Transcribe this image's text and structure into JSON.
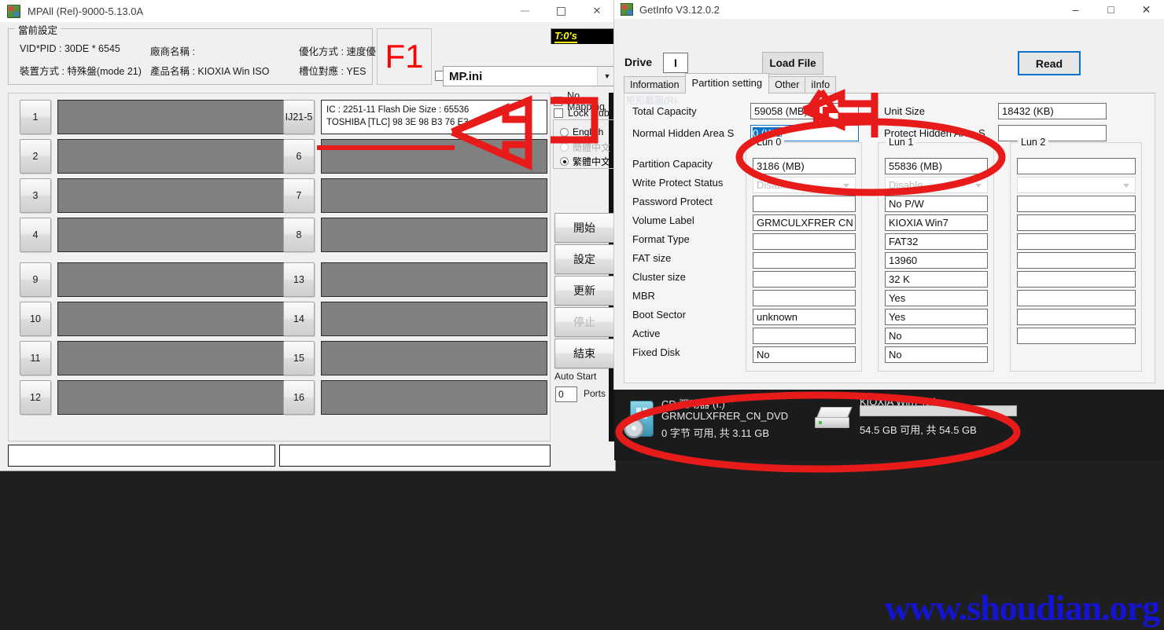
{
  "mpall": {
    "title": "MPAll (Rel)-9000-5.13.0A",
    "window_controls": {
      "minimize": "minimize-icon",
      "maximize": "maximize-icon",
      "close": "close-icon"
    },
    "current_settings": {
      "legend": "當前設定",
      "vid_pid": "VID*PID : 30DE * 6545",
      "device_mode": "裝置方式 : 特殊盤(mode 21)",
      "vendor": "廠商名稱 :",
      "product": "產品名稱 : KIOXIA Win ISO",
      "optimize": "優化方式 : 速度優",
      "slot_map": "槽位對應 : YES"
    },
    "f1_label": "F1",
    "timer_label": "T:0's",
    "ini_file": "MP.ini",
    "slots": {
      "left": [
        "1",
        "2",
        "3",
        "4",
        "9",
        "10",
        "11",
        "12"
      ],
      "right": [
        "IJ21-5",
        "6",
        "7",
        "8",
        "13",
        "14",
        "15",
        "16"
      ],
      "active_slot_info_line1": "IC : 2251-11  Flash Die Size : 65536",
      "active_slot_info_line2": "TOSHIBA [TLC] 98 3E 98 B3 76 E3"
    },
    "options": {
      "no_mapping": "No Mapping",
      "lock_hub": "Lock Hub"
    },
    "languages": [
      {
        "label": "English",
        "selected": false,
        "disabled": false
      },
      {
        "label": "簡體中文",
        "selected": false,
        "disabled": true
      },
      {
        "label": "繁體中文",
        "selected": true,
        "disabled": false
      }
    ],
    "buttons": [
      {
        "label": "開始",
        "disabled": false
      },
      {
        "label": "設定",
        "disabled": false
      },
      {
        "label": "更新",
        "disabled": false
      },
      {
        "label": "停止",
        "disabled": true
      },
      {
        "label": "結束",
        "disabled": false
      }
    ],
    "auto_start": {
      "label": "Auto Start",
      "value": "0",
      "units": "Ports"
    }
  },
  "getinfo": {
    "title": "GetInfo V3.12.0.2",
    "drive_label": "Drive",
    "drive_value": "I",
    "load_file_label": "Load File",
    "read_label": "Read",
    "tabs": [
      {
        "label": "Information",
        "active": false
      },
      {
        "label": "Partition setting",
        "active": true
      },
      {
        "label": "Other",
        "active": false
      },
      {
        "label": "iInfo",
        "active": false
      }
    ],
    "snip_overlay": "矩形截圖(R)",
    "top_fields": [
      {
        "label": "Total Capacity",
        "value": "59058 (MB)",
        "selected": false
      },
      {
        "label": "Unit Size",
        "value": "18432 (KB)",
        "selected": false
      },
      {
        "label": "Normal Hidden Area S",
        "value": "0 (KB)",
        "selected": true
      },
      {
        "label": "Protect Hidden Area S",
        "value": "",
        "selected": false
      }
    ],
    "row_labels": [
      "Partition Capacity",
      "Write Protect Status",
      "Password Protect",
      "Volume Label",
      "Format Type",
      "FAT size",
      "Cluster size",
      "MBR",
      "Boot Sector",
      "Active",
      "Fixed Disk"
    ],
    "luns": [
      {
        "name": "Lun 0",
        "values": [
          "3186 (MB)",
          "Disable",
          "",
          "GRMCULXFRER CN DV",
          "",
          "",
          "",
          "",
          "unknown",
          "",
          "No"
        ]
      },
      {
        "name": "Lun 1",
        "values": [
          "55836 (MB)",
          "Disable",
          "No P/W",
          "KIOXIA Win7",
          "FAT32",
          "13960",
          "32 K",
          "Yes",
          "Yes",
          "No",
          "No"
        ]
      },
      {
        "name": "Lun 2",
        "values": [
          "",
          "",
          "",
          "",
          "",
          "",
          "",
          "",
          "",
          "",
          ""
        ]
      }
    ]
  },
  "explorer": {
    "drives": [
      {
        "title": "CD 驱动器 (I:)",
        "label": "GRMCULXFRER_CN_DVD",
        "free": "0 字节 可用, 共 3.11 GB",
        "icon": "cd-drive-icon"
      },
      {
        "title": "KIOXIA Win7 (J:)",
        "label": "",
        "free": "54.5 GB 可用, 共 54.5 GB",
        "icon": "hard-drive-icon"
      }
    ]
  },
  "watermark": "www.shoudian.org",
  "colors": {
    "annotation_red": "#e81b1b",
    "accent_blue": "#0a72c8",
    "watermark_blue": "#1414d2",
    "timer_yellow": "#ffff00",
    "f1_red": "#ff0000"
  }
}
